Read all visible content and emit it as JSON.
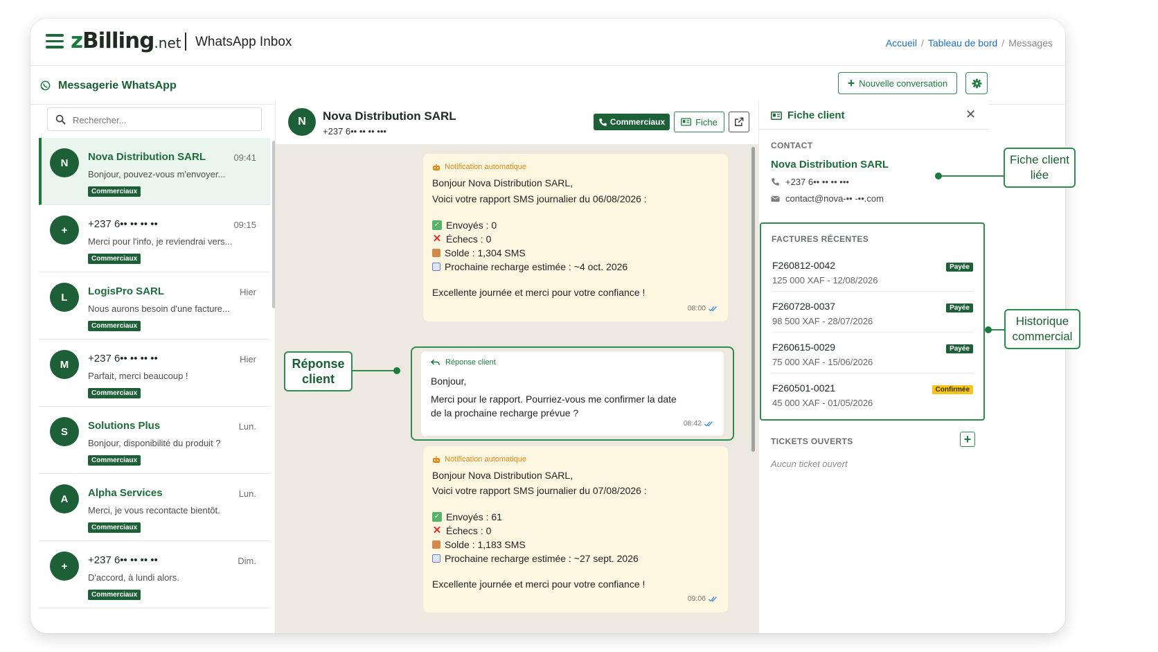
{
  "app": {
    "logo_z": "z",
    "logo_main": "Billing",
    "logo_net": ".net",
    "title": "WhatsApp Inbox"
  },
  "breadcrumb": {
    "items": [
      "Accueil",
      "Tableau de bord"
    ],
    "current": "Messages",
    "separator": "/"
  },
  "subbar": {
    "title": "Messagerie WhatsApp",
    "new_conversation": "Nouvelle conversation"
  },
  "search": {
    "placeholder": "Rechercher..."
  },
  "conversations": [
    {
      "initial": "N",
      "name": "Nova Distribution SARL",
      "time": "09:41",
      "snippet": "Bonjour, pouvez-vous m'envoyer...",
      "tag": "Commerciaux",
      "active": true
    },
    {
      "initial": "+",
      "name": "+237 6•• •• •• ••",
      "time": "09:15",
      "snippet": "Merci pour l'info, je reviendrai vers...",
      "tag": "Commerciaux"
    },
    {
      "initial": "L",
      "name": "LogisPro SARL",
      "time": "Hier",
      "snippet": "Nous aurons besoin d'une facture...",
      "tag": "Commerciaux"
    },
    {
      "initial": "M",
      "name": "+237 6•• •• •• ••",
      "time": "Hier",
      "snippet": "Parfait, merci beaucoup !",
      "tag": "Commerciaux"
    },
    {
      "initial": "S",
      "name": "Solutions Plus",
      "time": "Lun.",
      "snippet": "Bonjour, disponibilité du produit ?",
      "tag": "Commerciaux"
    },
    {
      "initial": "A",
      "name": "Alpha Services",
      "time": "Lun.",
      "snippet": "Merci, je vous recontacte bientôt.",
      "tag": "Commerciaux"
    },
    {
      "initial": "+",
      "name": "+237 6•• •• •• ••",
      "time": "Dim.",
      "snippet": "D'accord, à lundi alors.",
      "tag": "Commerciaux"
    }
  ],
  "chat": {
    "initial": "N",
    "name": "Nova Distribution SARL",
    "phone": "+237 6•• •• •• •••",
    "btn_commerciaux": "Commerciaux",
    "btn_fiche": "Fiche",
    "messages": [
      {
        "label": "Notification automatique",
        "greeting": "Bonjour Nova Distribution SARL,",
        "intro": "Voici votre rapport SMS journalier du 06/08/2026 :",
        "sent": "Envoyés : 0",
        "failed": "Échecs : 0",
        "balance": "Solde : 1,304 SMS",
        "next": "Prochaine recharge estimée : ~4 oct. 2026",
        "closing": "Excellente journée et merci pour votre confiance !",
        "time": "08:00"
      },
      {
        "label": "Notification automatique",
        "greeting": "Bonjour Nova Distribution SARL,",
        "intro": "Voici votre rapport SMS journalier du 07/08/2026 :",
        "sent": "Envoyés : 61",
        "failed": "Échecs : 0",
        "balance": "Solde : 1,183 SMS",
        "next": "Prochaine recharge estimée : ~27 sept. 2026",
        "closing": "Excellente journée et merci pour votre confiance !",
        "time": "09:06"
      }
    ],
    "reply": {
      "label": "Réponse client",
      "line1": "Bonjour,",
      "line2": "Merci pour le rapport. Pourriez-vous me confirmer la date",
      "line3": "de la prochaine recharge prévue ?",
      "time": "08:42"
    }
  },
  "fiche": {
    "title": "Fiche client",
    "contact_label": "CONTACT",
    "contact_name": "Nova Distribution SARL",
    "phone": "+237 6•• •• •• •••",
    "email": "contact@nova-•• -••.com",
    "factures_label": "FACTURES RÉCENTES",
    "invoices": [
      {
        "number": "F260812-0042",
        "detail": "125 000 XAF - 12/08/2026",
        "status": "Payée"
      },
      {
        "number": "F260728-0037",
        "detail": "98 500 XAF - 28/07/2026",
        "status": "Payée"
      },
      {
        "number": "F260615-0029",
        "detail": "75 000 XAF - 15/06/2026",
        "status": "Payée"
      },
      {
        "number": "F260501-0021",
        "detail": "45 000 XAF - 01/05/2026",
        "status": "Confirmée"
      }
    ],
    "tickets_label": "TICKETS OUVERTS",
    "no_ticket": "Aucun ticket ouvert"
  },
  "callouts": {
    "fiche_client_l1": "Fiche client",
    "fiche_client_l2": "liée",
    "historique_l1": "Historique",
    "historique_l2": "commercial",
    "reponse_l1": "Réponse",
    "reponse_l2": "client"
  },
  "colors": {
    "brand_green": "#1d5f36",
    "accent_green": "#2e8b4f",
    "notification_bg": "#fdf6e0",
    "chat_bg": "#ede8e0",
    "status_confirmed": "#f5c518"
  }
}
